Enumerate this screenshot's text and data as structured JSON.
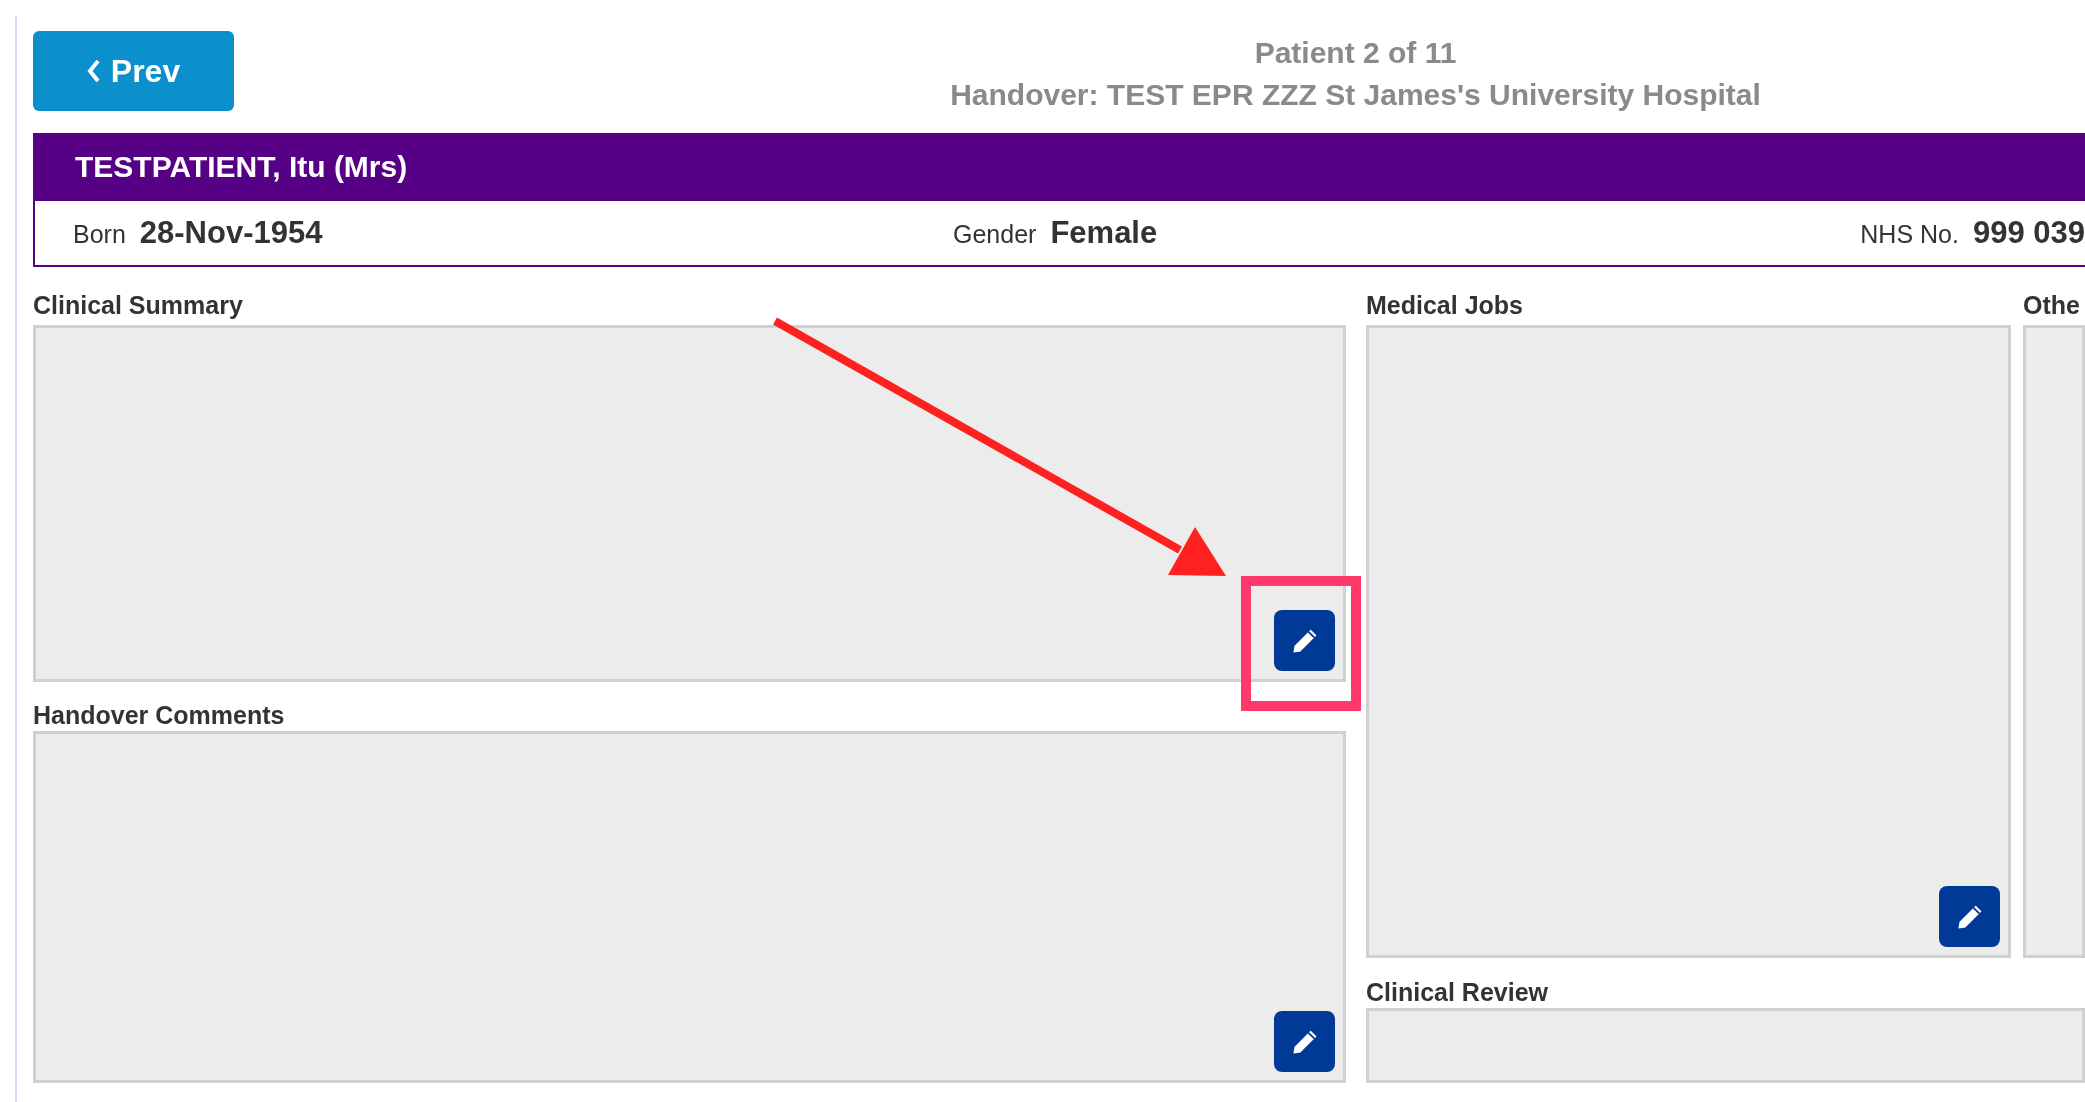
{
  "prev_button": {
    "label": "Prev"
  },
  "header": {
    "title": "Patient 2 of 11",
    "subtitle": "Handover: TEST EPR ZZZ St James's University Hospital"
  },
  "patient": {
    "name": "TESTPATIENT, Itu (Mrs)",
    "fields": [
      {
        "label": "Born",
        "value": "28-Nov-1954"
      },
      {
        "label": "Gender",
        "value": "Female"
      },
      {
        "label": "NHS No.",
        "value": "999 039"
      }
    ]
  },
  "panels": [
    {
      "title": "Clinical Summary",
      "editable": true,
      "highlighted": true
    },
    {
      "title": "Handover Comments",
      "editable": true,
      "highlighted": false
    },
    {
      "title": "Medical Jobs",
      "editable": true,
      "highlighted": false
    },
    {
      "title": "Othe",
      "editable": false,
      "highlighted": false
    },
    {
      "title": "Clinical Review",
      "editable": false,
      "highlighted": false
    }
  ]
}
